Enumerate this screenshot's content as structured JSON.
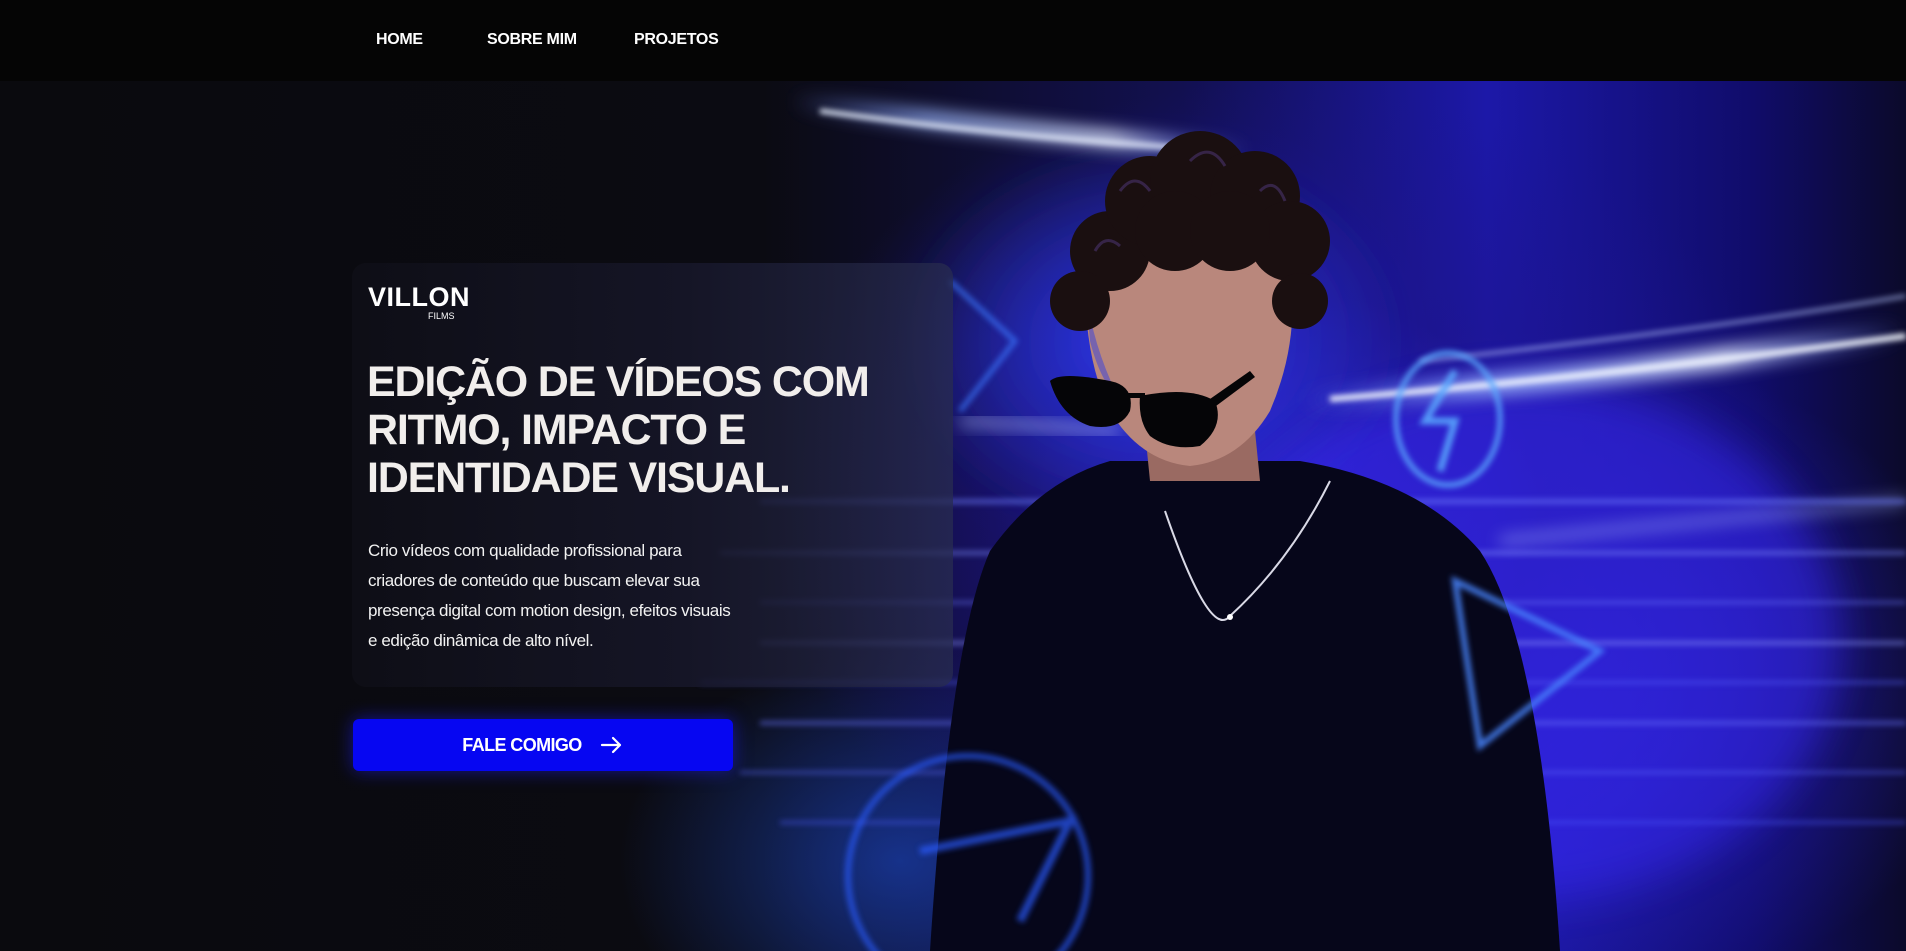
{
  "nav": {
    "items": [
      {
        "label": "HOME"
      },
      {
        "label": "SOBRE MIM"
      },
      {
        "label": "PROJETOS"
      }
    ]
  },
  "logo": {
    "main": "VILLON",
    "sub": "FILMS"
  },
  "hero": {
    "headline_lines": [
      "EDIÇÃO DE VÍDEOS COM",
      "RITMO, IMPACTO E",
      "IDENTIDADE VISUAL."
    ],
    "description_lines": [
      "Crio vídeos com qualidade profissional para",
      "criadores de conteúdo que buscam elevar sua",
      "presença digital com motion design, efeitos visuais",
      "e edição dinâmica de alto nível."
    ]
  },
  "cta": {
    "label": "FALE COMIGO",
    "icon": "arrow-right-icon"
  },
  "colors": {
    "cta_background": "#0606f2",
    "navbar_background": "#050505",
    "page_background": "#0a0a0e",
    "headline_text": "#f1eeec"
  }
}
